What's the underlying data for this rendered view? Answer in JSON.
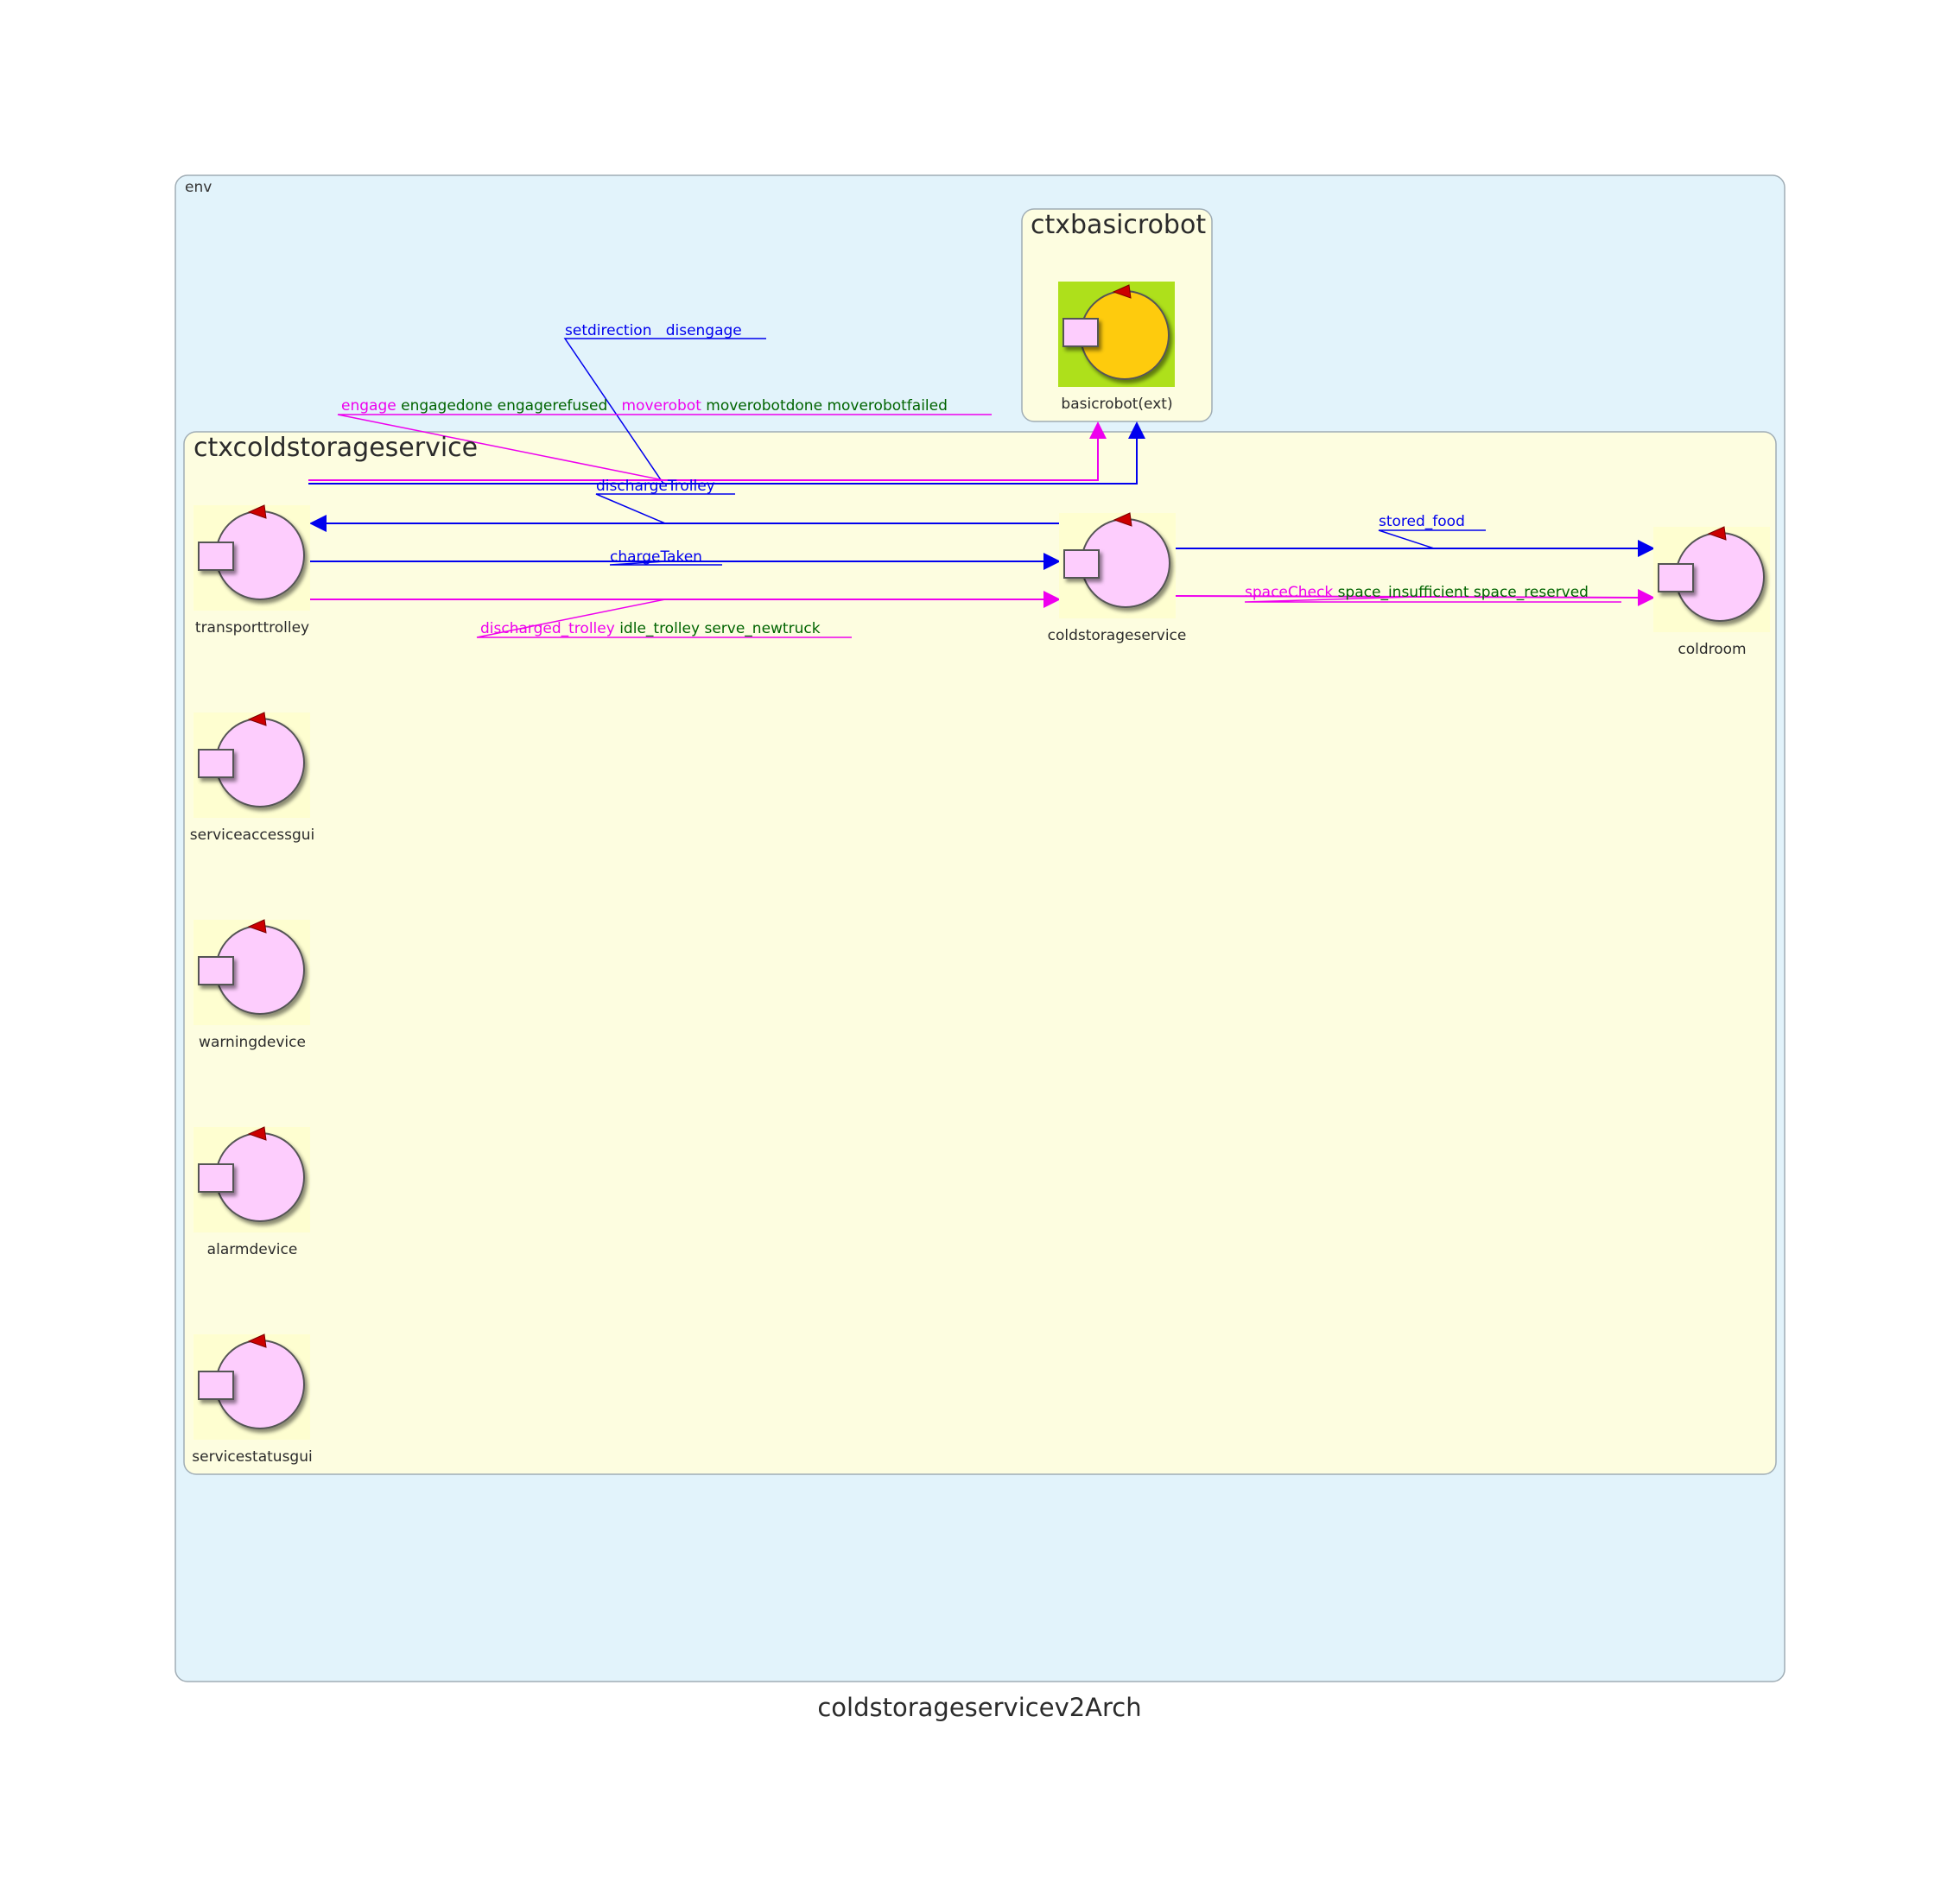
{
  "diagram": {
    "caption": "coldstorageservicev2Arch",
    "env_label": "env",
    "contexts": {
      "basicrobot": {
        "title": "ctxbasicrobot"
      },
      "coldstorage": {
        "title": "ctxcoldstorageservice"
      }
    },
    "actors": {
      "basicrobot": "basicrobot(ext)",
      "transporttrolley": "transporttrolley",
      "coldstorageservice": "coldstorageservice",
      "coldroom": "coldroom",
      "serviceaccessgui": "serviceaccessgui",
      "warningdevice": "warningdevice",
      "alarmdevice": "alarmdevice",
      "servicestatusgui": "servicestatusgui"
    },
    "messages": {
      "setdirection": "setdirection",
      "disengage": "disengage",
      "engage": "engage",
      "engagedone": "engagedone",
      "engagerefused": "engagerefused",
      "moverobot": "moverobot",
      "moverobotdone": "moverobotdone",
      "moverobotfailed": "moverobotfailed",
      "dischargeTrolley": "dischargeTrolley",
      "chargeTaken": "chargeTaken",
      "discharged_trolley": "discharged_trolley",
      "idle_trolley": "idle_trolley",
      "serve_newtruck": "serve_newtruck",
      "stored_food": "stored_food",
      "spaceCheck": "spaceCheck",
      "space_insufficient": "space_insufficient",
      "space_reserved": "space_reserved"
    },
    "colors": {
      "env_fill": "#e2f3fb",
      "context_fill": "#fdfde0",
      "actor_fill": "#fdcdfd",
      "external_actor_fill": "#fecb0c",
      "external_bg": "#aee01b",
      "dispatch": "#0000ee",
      "request": "#ee00ee",
      "reply": "#006400"
    }
  }
}
